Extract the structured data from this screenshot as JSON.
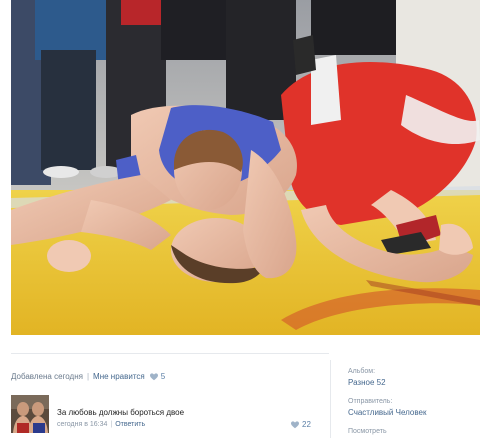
{
  "post": {
    "added": "Добавлена сегодня",
    "like_label": "Мне нравится",
    "like_count": "5"
  },
  "comment": {
    "text": "За любовь должны бороться двое",
    "date": "сегодня в 16:34",
    "reply_label": "Ответить",
    "like_count": "22"
  },
  "side": {
    "album_label": "Альбом:",
    "album_value": "Разное 52",
    "sender_label": "Отправитель:",
    "sender_value": "Счастливый Человек",
    "more_label": "Посмотреть"
  },
  "icons": {
    "like": "heart-icon",
    "comment_like": "heart-icon"
  },
  "colors": {
    "link": "#45688e",
    "muted": "#8a97a6",
    "mat": "#e8c12a",
    "singlet_red": "#e0332a",
    "singlet_blue": "#4d5fc7"
  }
}
